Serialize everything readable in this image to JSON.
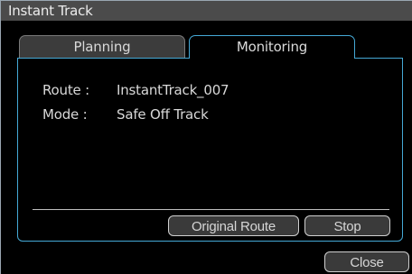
{
  "window": {
    "title": "Instant Track"
  },
  "tabs": [
    {
      "label": "Planning",
      "active": false
    },
    {
      "label": "Monitoring",
      "active": true
    }
  ],
  "monitoring": {
    "route_label": "Route :",
    "route_value": "InstantTrack_007",
    "mode_label": "Mode :",
    "mode_value": "Safe Off Track"
  },
  "buttons": {
    "original_route": "Original Route",
    "stop": "Stop",
    "close": "Close"
  },
  "colors": {
    "background": "#000000",
    "title_bar": "#4b4b4b",
    "active_tab_border": "#45a9d6",
    "button_fill": "#3a3a3a",
    "text": "#d8d8d8"
  }
}
